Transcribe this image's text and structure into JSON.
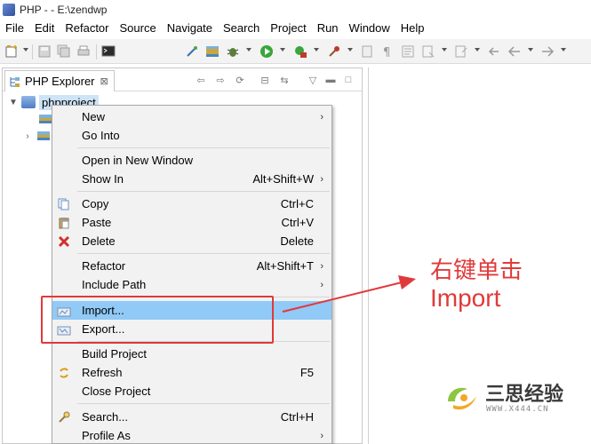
{
  "window": {
    "title": "PHP -  - E:\\zendwp"
  },
  "menubar": [
    "File",
    "Edit",
    "Refactor",
    "Source",
    "Navigate",
    "Search",
    "Project",
    "Run",
    "Window",
    "Help"
  ],
  "panel": {
    "tab_label": "PHP Explorer",
    "tab_close": "⊠",
    "project_name": "phpproject"
  },
  "context_menu": {
    "items": [
      {
        "label": "New",
        "shortcut": "",
        "submenu": true,
        "icon": ""
      },
      {
        "label": "Go Into",
        "shortcut": "",
        "submenu": false,
        "icon": ""
      },
      {
        "label": "Open in New Window",
        "shortcut": "",
        "submenu": false,
        "icon": ""
      },
      {
        "label": "Show In",
        "shortcut": "Alt+Shift+W",
        "submenu": true,
        "icon": ""
      },
      {
        "label": "Copy",
        "shortcut": "Ctrl+C",
        "submenu": false,
        "icon": "copy-icon"
      },
      {
        "label": "Paste",
        "shortcut": "Ctrl+V",
        "submenu": false,
        "icon": "paste-icon"
      },
      {
        "label": "Delete",
        "shortcut": "Delete",
        "submenu": false,
        "icon": "delete-icon"
      },
      {
        "label": "Refactor",
        "shortcut": "Alt+Shift+T",
        "submenu": true,
        "icon": ""
      },
      {
        "label": "Include Path",
        "shortcut": "",
        "submenu": true,
        "icon": ""
      },
      {
        "label": "Import...",
        "shortcut": "",
        "submenu": false,
        "icon": "import-icon",
        "highlighted": true
      },
      {
        "label": "Export...",
        "shortcut": "",
        "submenu": false,
        "icon": "export-icon"
      },
      {
        "label": "Build Project",
        "shortcut": "",
        "submenu": false,
        "icon": ""
      },
      {
        "label": "Refresh",
        "shortcut": "F5",
        "submenu": false,
        "icon": "refresh-icon"
      },
      {
        "label": "Close Project",
        "shortcut": "",
        "submenu": false,
        "icon": ""
      },
      {
        "label": "Search...",
        "shortcut": "Ctrl+H",
        "submenu": false,
        "icon": "search-icon"
      },
      {
        "label": "Profile As",
        "shortcut": "",
        "submenu": true,
        "icon": ""
      }
    ],
    "submenu_arrow": "›"
  },
  "annotation": {
    "line1": "右键单击",
    "line2": "Import",
    "color": "#e03a3a"
  },
  "watermark": {
    "name": "三思经验",
    "url": "WWW.X444.CN"
  },
  "colors": {
    "highlight": "#91c9f7",
    "project_selection": "#cde3f7",
    "annotation_red": "#e0393a"
  }
}
